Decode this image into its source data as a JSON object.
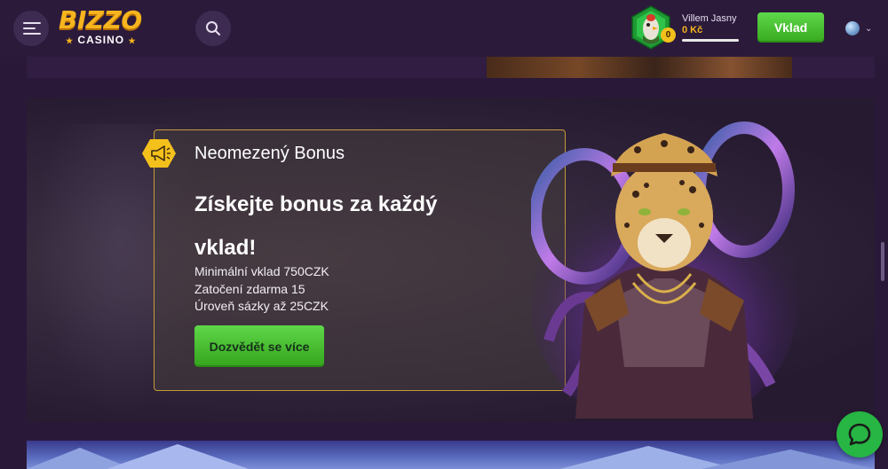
{
  "header": {
    "menu_icon": "hamburger-menu-icon",
    "logo": {
      "top": "BIZZO",
      "bottom": "CASINO"
    },
    "search_icon": "search-icon",
    "user": {
      "name": "Villem Jasny",
      "balance": "0 Kč",
      "level_badge": "0"
    },
    "deposit_label": "Vklad",
    "language_icon": "globe-icon"
  },
  "promo": {
    "label": "Neomezený Bonus",
    "title": "Získejte bonus za každý vklad!",
    "lines": [
      "Minimální vklad 750CZK",
      "Zatočení zdarma 15",
      "Úroveň sázky až 25CZK"
    ],
    "button_label": "Dozvědět se více"
  },
  "colors": {
    "background": "#2a1838",
    "accent_green": "#3fbd2a",
    "brand_gold": "#f6b51e",
    "card_border": "#c49a3a"
  }
}
